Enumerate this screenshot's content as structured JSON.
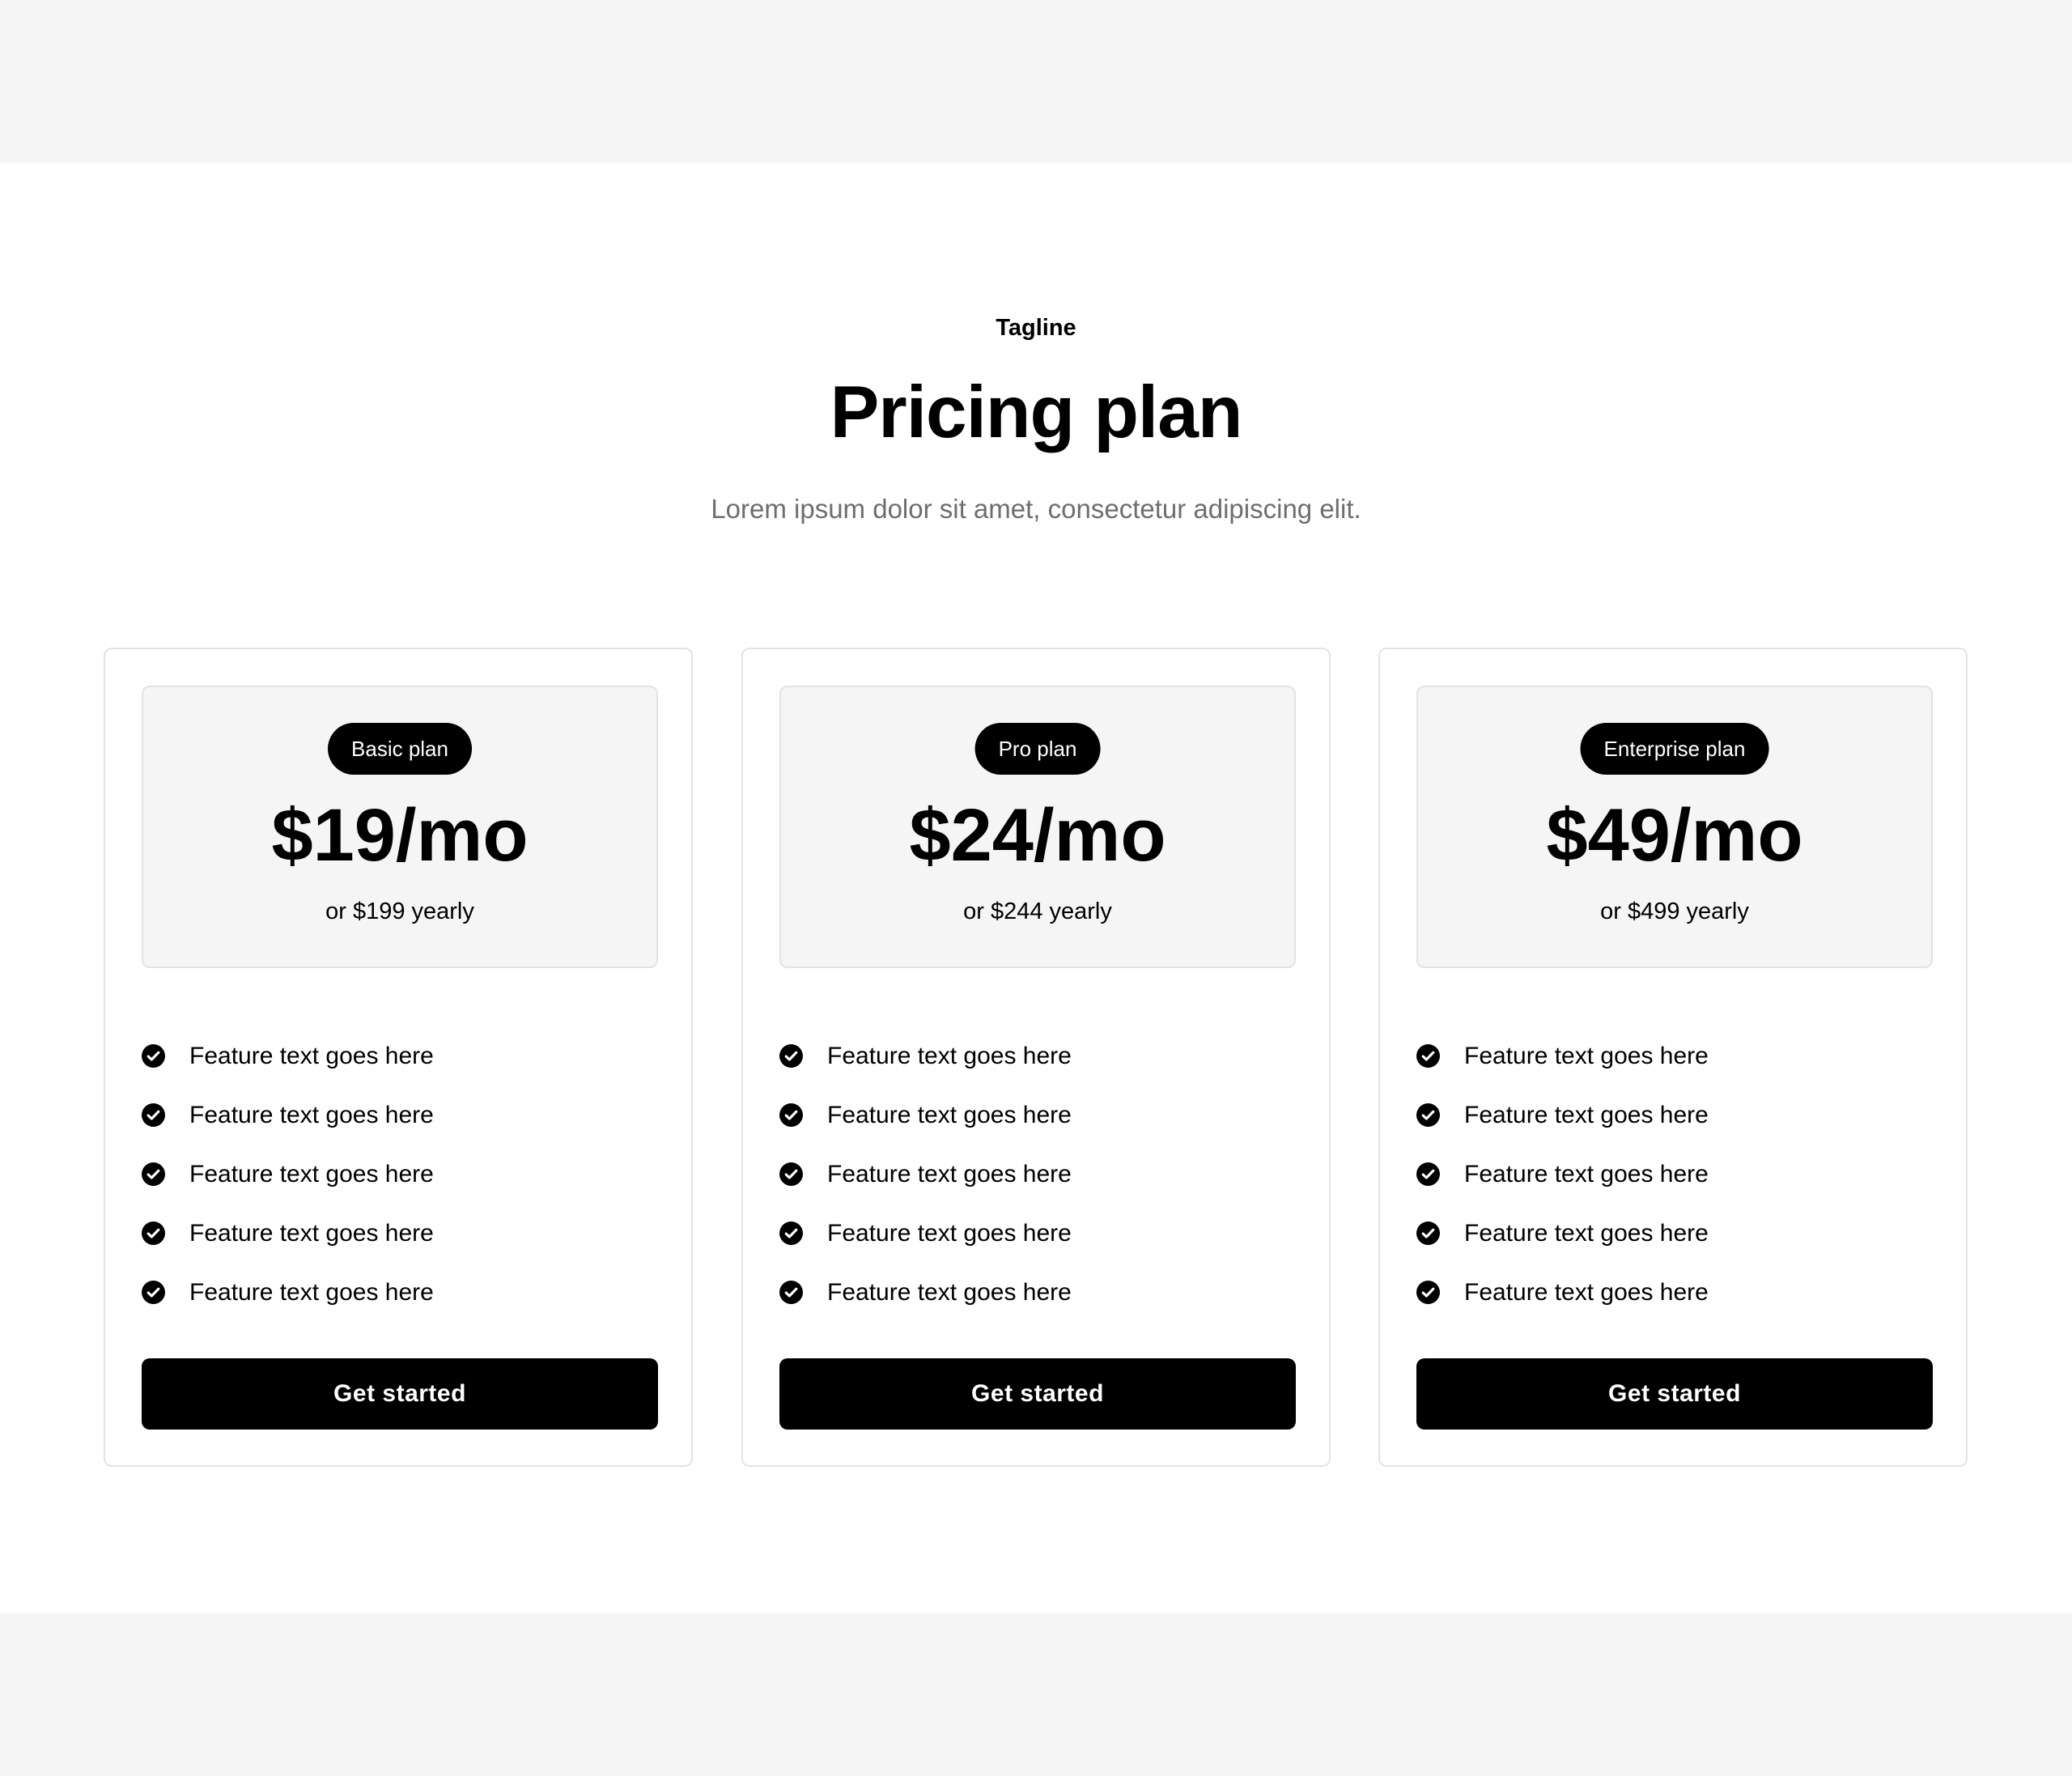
{
  "header": {
    "tagline": "Tagline",
    "title": "Pricing plan",
    "subtitle": "Lorem ipsum dolor sit amet, consectetur adipiscing elit."
  },
  "plans": [
    {
      "badge": "Basic plan",
      "price": "$19/mo",
      "yearly": "or $199 yearly",
      "features": [
        "Feature text goes here",
        "Feature text goes here",
        "Feature text goes here",
        "Feature text goes here",
        "Feature text goes here"
      ],
      "cta": "Get started"
    },
    {
      "badge": "Pro plan",
      "price": "$24/mo",
      "yearly": "or $244 yearly",
      "features": [
        "Feature text goes here",
        "Feature text goes here",
        "Feature text goes here",
        "Feature text goes here",
        "Feature text goes here"
      ],
      "cta": "Get started"
    },
    {
      "badge": "Enterprise plan",
      "price": "$49/mo",
      "yearly": "or $499 yearly",
      "features": [
        "Feature text goes here",
        "Feature text goes here",
        "Feature text goes here",
        "Feature text goes here",
        "Feature text goes here"
      ],
      "cta": "Get started"
    }
  ],
  "icons": {
    "feature_check": "check-circle-icon"
  },
  "colors": {
    "page_background": "#f5f5f5",
    "section_background": "#ffffff",
    "accent": "#000000",
    "subtitle_text": "#6e6e6e",
    "border": "#e3e3e3"
  }
}
